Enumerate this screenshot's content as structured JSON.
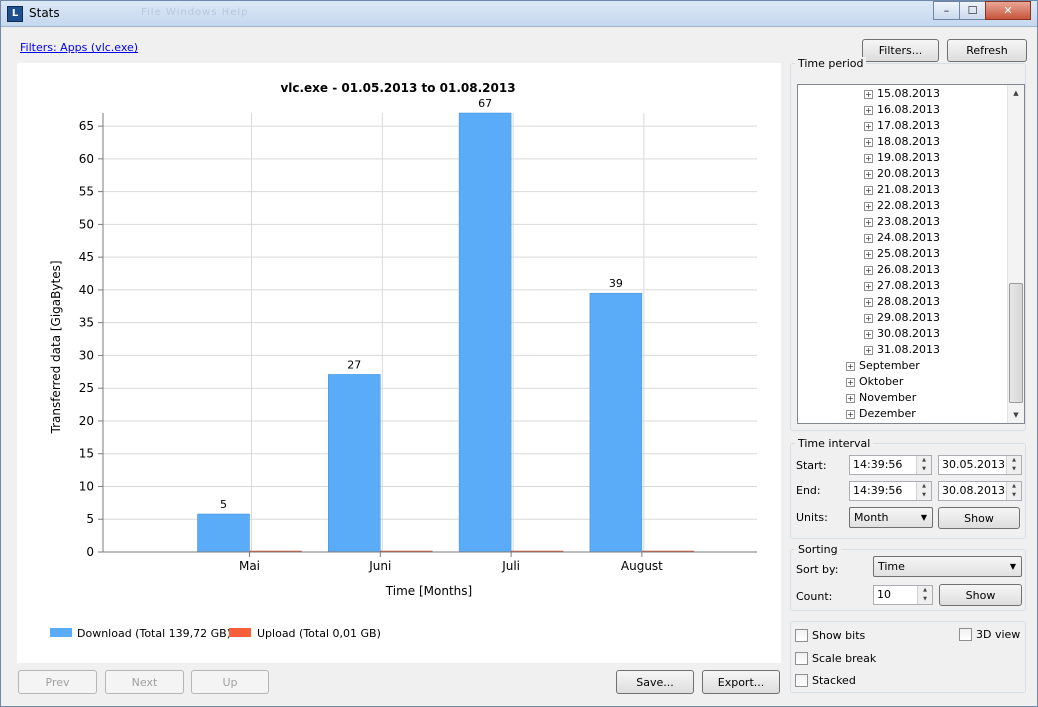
{
  "window": {
    "title": "Stats",
    "ghost_menu": "File  Windows  Help",
    "minimize": "–",
    "maximize": "☐",
    "close": "✕"
  },
  "filters_link": "Filters: Apps (vlc.exe)",
  "toolbar": {
    "filters_button": "Filters...",
    "refresh_button": "Refresh"
  },
  "chart_data": {
    "type": "bar",
    "title": "vlc.exe - 01.05.2013 to 01.08.2013",
    "xlabel": "Time [Months]",
    "ylabel": "Transferred data [GigaBytes]",
    "categories": [
      "Mai",
      "Juni",
      "Juli",
      "August"
    ],
    "ylim": [
      0,
      67
    ],
    "yticks": [
      "0",
      "5",
      "10",
      "15",
      "20",
      "25",
      "30",
      "35",
      "40",
      "45",
      "50",
      "55",
      "60",
      "65"
    ],
    "grid": true,
    "legend_position": "bottom-left",
    "series": [
      {
        "name": "Download (Total 139,72 GB)",
        "color": "#5aabf8",
        "values": [
          5.8,
          27.1,
          67,
          39.5
        ],
        "labels": [
          "5",
          "27",
          "67",
          "39"
        ]
      },
      {
        "name": "Upload (Total 0,01 GB)",
        "color": "#f75f3c",
        "values": [
          0.01,
          0.01,
          0.01,
          0.01
        ],
        "labels": [
          "",
          "",
          "",
          ""
        ]
      }
    ]
  },
  "nav": {
    "prev": "Prev",
    "next": "Next",
    "up": "Up",
    "save": "Save...",
    "export": "Export..."
  },
  "time_period": {
    "title": "Time period",
    "days": [
      "15.08.2013",
      "16.08.2013",
      "17.08.2013",
      "18.08.2013",
      "19.08.2013",
      "20.08.2013",
      "21.08.2013",
      "22.08.2013",
      "23.08.2013",
      "24.08.2013",
      "25.08.2013",
      "26.08.2013",
      "27.08.2013",
      "28.08.2013",
      "29.08.2013",
      "30.08.2013",
      "31.08.2013"
    ],
    "months": [
      "September",
      "Oktober",
      "November",
      "Dezember"
    ]
  },
  "time_interval": {
    "title": "Time interval",
    "start_label": "Start:",
    "start_time": "14:39:56",
    "start_date": "30.05.2013",
    "end_label": "End:",
    "end_time": "14:39:56",
    "end_date": "30.08.2013",
    "units_label": "Units:",
    "units_value": "Month",
    "show_button": "Show"
  },
  "sorting": {
    "title": "Sorting",
    "sort_by_label": "Sort by:",
    "sort_by_value": "Time",
    "count_label": "Count:",
    "count_value": "10",
    "show_button": "Show"
  },
  "options": {
    "show_bits": "Show bits",
    "scale_break": "Scale break",
    "stacked": "Stacked",
    "view_3d": "3D view"
  }
}
